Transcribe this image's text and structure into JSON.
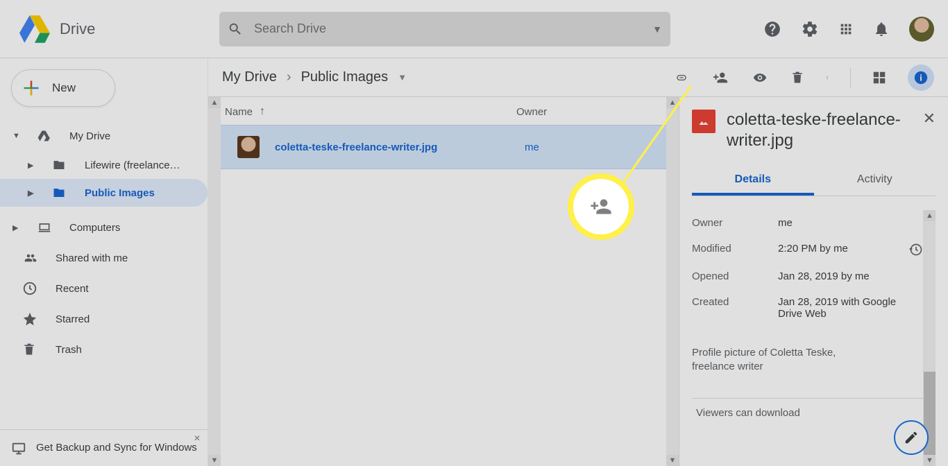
{
  "header": {
    "product_name": "Drive",
    "search_placeholder": "Search Drive"
  },
  "sidebar": {
    "new_button_label": "New",
    "my_drive_label": "My Drive",
    "folders": [
      {
        "label": "Lifewire (freelance…"
      },
      {
        "label": "Public Images"
      }
    ],
    "computers_label": "Computers",
    "shared_label": "Shared with me",
    "recent_label": "Recent",
    "starred_label": "Starred",
    "trash_label": "Trash",
    "promo_label": "Get Backup and Sync for Windows"
  },
  "breadcrumb": {
    "root": "My Drive",
    "current": "Public Images"
  },
  "list": {
    "column_name": "Name",
    "column_owner": "Owner",
    "files": [
      {
        "name": "coletta-teske-freelance-writer.jpg",
        "owner": "me"
      }
    ]
  },
  "details": {
    "title": "coletta-teske-freelance-writer.jpg",
    "tabs": {
      "details": "Details",
      "activity": "Activity"
    },
    "owner_label": "Owner",
    "owner_value": "me",
    "modified_label": "Modified",
    "modified_value": "2:20 PM by me",
    "opened_label": "Opened",
    "opened_value": "Jan 28, 2019 by me",
    "created_label": "Created",
    "created_value": "Jan 28, 2019 with Google Drive Web",
    "description": "Profile picture of Coletta Teske, freelance writer",
    "footer": "Viewers can download"
  }
}
